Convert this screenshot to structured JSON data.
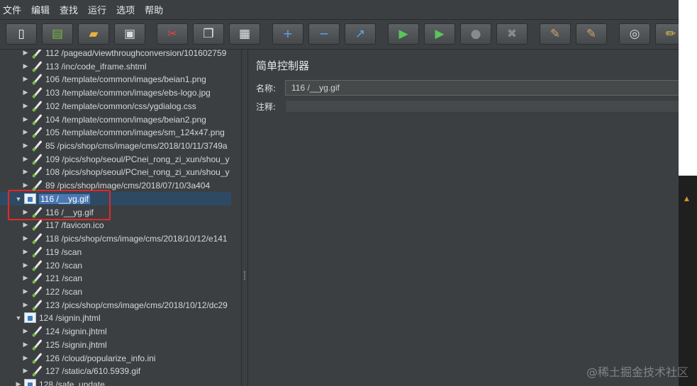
{
  "menubar": [
    "文件",
    "编辑",
    "查找",
    "运行",
    "选项",
    "帮助"
  ],
  "toolbar": [
    {
      "icon": "new-icon",
      "glyph": "▯",
      "color": "#f2f2f2"
    },
    {
      "icon": "templates-icon",
      "glyph": "▤",
      "color": "#76b84a"
    },
    {
      "icon": "open-icon",
      "glyph": "▰",
      "color": "#e8b33c"
    },
    {
      "icon": "save-icon",
      "glyph": "▣",
      "color": "#dcdcdc"
    },
    {
      "icon": "cut-icon",
      "glyph": "✂",
      "color": "#e0453a"
    },
    {
      "icon": "copy-icon",
      "glyph": "❐",
      "color": "#e8e8e8"
    },
    {
      "icon": "paste-icon",
      "glyph": "▦",
      "color": "#e8e8e8"
    },
    {
      "icon": "expand-icon",
      "glyph": "+",
      "color": "#5aa5f0"
    },
    {
      "icon": "collapse-icon",
      "glyph": "−",
      "color": "#5aa5f0"
    },
    {
      "icon": "toggle-icon",
      "glyph": "↗",
      "color": "#5aa5f0"
    },
    {
      "icon": "start-icon",
      "glyph": "▶",
      "color": "#5bc45b"
    },
    {
      "icon": "start-no-pauses-icon",
      "glyph": "▶",
      "color": "#5bc45b"
    },
    {
      "icon": "stop-icon",
      "glyph": "●",
      "color": "#8a8a8a"
    },
    {
      "icon": "shutdown-icon",
      "glyph": "✖",
      "color": "#8a8a8a"
    },
    {
      "icon": "clear-icon",
      "glyph": "✎",
      "color": "#c9a36a"
    },
    {
      "icon": "clear-all-icon",
      "glyph": "✎",
      "color": "#c9a36a"
    },
    {
      "icon": "search-icon",
      "glyph": "◎",
      "color": "#d8d8d8"
    },
    {
      "icon": "reset-search-icon",
      "glyph": "✏",
      "color": "#e8c240"
    }
  ],
  "tree": [
    {
      "label": "112 /pagead/viewthroughconversion/101602759",
      "indent": 1,
      "type": "sampler",
      "expanded": false
    },
    {
      "label": "113 /inc/code_iframe.shtml",
      "indent": 1,
      "type": "sampler",
      "expanded": false
    },
    {
      "label": "106 /template/common/images/beian1.png",
      "indent": 1,
      "type": "sampler",
      "expanded": false
    },
    {
      "label": "103 /template/common/images/ebs-logo.jpg",
      "indent": 1,
      "type": "sampler",
      "expanded": false
    },
    {
      "label": "102 /template/common/css/ygdialog.css",
      "indent": 1,
      "type": "sampler",
      "expanded": false
    },
    {
      "label": "104 /template/common/images/beian2.png",
      "indent": 1,
      "type": "sampler",
      "expanded": false
    },
    {
      "label": "105 /template/common/images/sm_124x47.png",
      "indent": 1,
      "type": "sampler",
      "expanded": false
    },
    {
      "label": "85 /pics/shop/cms/image/cms/2018/10/11/3749a",
      "indent": 1,
      "type": "sampler",
      "expanded": false
    },
    {
      "label": "109 /pics/shop/seoul/PCnei_rong_zi_xun/shou_y",
      "indent": 1,
      "type": "sampler",
      "expanded": false
    },
    {
      "label": "108 /pics/shop/seoul/PCnei_rong_zi_xun/shou_y",
      "indent": 1,
      "type": "sampler",
      "expanded": false
    },
    {
      "label": "89 /pics/shop/image/cms/2018/07/10/3a404",
      "indent": 1,
      "type": "sampler",
      "expanded": false
    },
    {
      "label": "116 /__yg.gif",
      "indent": 0,
      "type": "controller",
      "expanded": true,
      "selected": true
    },
    {
      "label": "116 /__yg.gif",
      "indent": 1,
      "type": "sampler",
      "expanded": false
    },
    {
      "label": "117 /favicon.ico",
      "indent": 1,
      "type": "sampler",
      "expanded": false
    },
    {
      "label": "118 /pics/shop/cms/image/cms/2018/10/12/e141",
      "indent": 1,
      "type": "sampler",
      "expanded": false
    },
    {
      "label": "119 /scan",
      "indent": 1,
      "type": "sampler",
      "expanded": false
    },
    {
      "label": "120 /scan",
      "indent": 1,
      "type": "sampler",
      "expanded": false
    },
    {
      "label": "121 /scan",
      "indent": 1,
      "type": "sampler",
      "expanded": false
    },
    {
      "label": "122 /scan",
      "indent": 1,
      "type": "sampler",
      "expanded": false
    },
    {
      "label": "123 /pics/shop/cms/image/cms/2018/10/12/dc29",
      "indent": 1,
      "type": "sampler",
      "expanded": false
    },
    {
      "label": "124 /signin.jhtml",
      "indent": 0,
      "type": "controller",
      "expanded": true
    },
    {
      "label": "124 /signin.jhtml",
      "indent": 1,
      "type": "sampler",
      "expanded": false
    },
    {
      "label": "125 /signin.jhtml",
      "indent": 1,
      "type": "sampler",
      "expanded": false
    },
    {
      "label": "126 /cloud/popularize_info.ini",
      "indent": 1,
      "type": "sampler",
      "expanded": false
    },
    {
      "label": "127 /static/a/610.5939.gif",
      "indent": 1,
      "type": "sampler",
      "expanded": false
    },
    {
      "label": "128 /safe_update",
      "indent": 0,
      "type": "controller",
      "expanded": false
    }
  ],
  "panel": {
    "title": "简单控制器",
    "name_label": "名称:",
    "name_value": "116 /__yg.gif",
    "comment_label": "注释:",
    "comment_value": ""
  },
  "watermark": "@稀土掘金技术社区"
}
